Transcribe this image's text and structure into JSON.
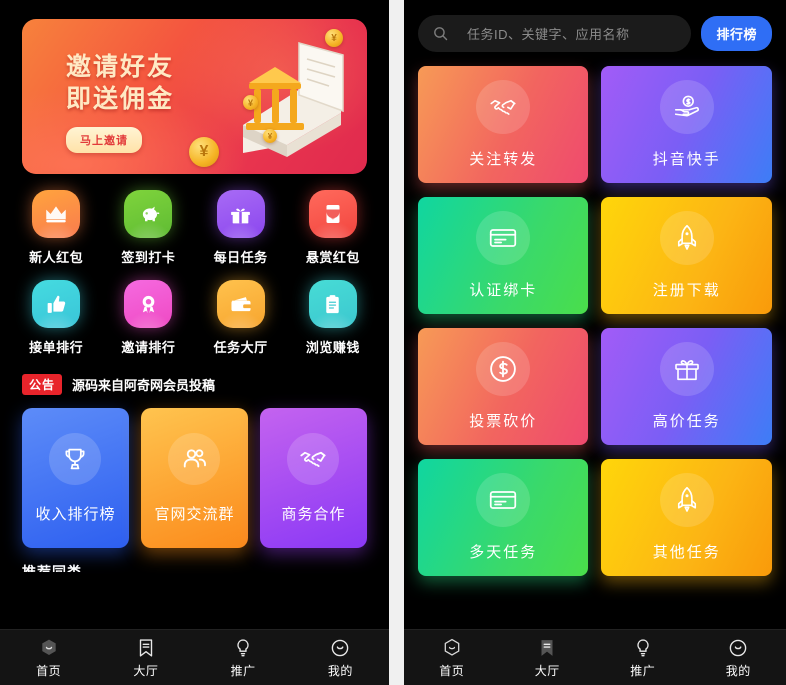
{
  "left_panel": {
    "banner": {
      "line1": "邀请好友",
      "line2": "即送佣金",
      "button": "马上邀请",
      "icon_art": "bank-books-coins-illustration"
    },
    "icon_grid": [
      {
        "label": "新人红包",
        "icon": "crown-icon",
        "color": "#f97b4e"
      },
      {
        "label": "签到打卡",
        "icon": "piggy-bank-icon",
        "color": "#5fbb33"
      },
      {
        "label": "每日任务",
        "icon": "gift-icon",
        "color": "#8b46ee"
      },
      {
        "label": "悬赏红包",
        "icon": "red-packet-icon",
        "color": "#f2453f"
      },
      {
        "label": "接单排行",
        "icon": "thumbs-up-icon",
        "color": "#39c5d8"
      },
      {
        "label": "邀请排行",
        "icon": "medal-icon",
        "color": "#ef49c3"
      },
      {
        "label": "任务大厅",
        "icon": "wallet-icon",
        "color": "#f7a52f"
      },
      {
        "label": "浏览赚钱",
        "icon": "clipboard-icon",
        "color": "#3cc7cf"
      }
    ],
    "notice": {
      "badge": "公告",
      "text": "源码来自阿奇网会员投稿",
      "badge_color": "#e8242b"
    },
    "cards": [
      {
        "label": "收入排行榜",
        "icon": "trophy-icon",
        "color": "#2d5ff0"
      },
      {
        "label": "官网交流群",
        "icon": "people-group-icon",
        "color": "#fb8a1b"
      },
      {
        "label": "商务合作",
        "icon": "handshake-icon",
        "color": "#8a38f5"
      }
    ],
    "section_heading_partial": "推荐同类",
    "tabbar": [
      {
        "label": "首页",
        "icon": "home-hex-smile-icon",
        "active": true
      },
      {
        "label": "大厅",
        "icon": "bookmark-list-icon",
        "active": false
      },
      {
        "label": "推广",
        "icon": "bulb-icon",
        "active": false
      },
      {
        "label": "我的",
        "icon": "user-smile-circle-icon",
        "active": false
      }
    ]
  },
  "right_panel": {
    "search": {
      "placeholder": "任务ID、关键字、应用名称",
      "icon": "search-icon",
      "value": ""
    },
    "rank_button": {
      "label": "排行榜",
      "color": "#2f6ef5"
    },
    "tiles": [
      {
        "label": "关注转发",
        "icon": "handshake-icon",
        "color": "#f2655f"
      },
      {
        "label": "抖音快手",
        "icon": "hand-coin-icon",
        "color": "#7b5ef5"
      },
      {
        "label": "认证绑卡",
        "icon": "credit-card-icon",
        "color": "#3ad96a"
      },
      {
        "label": "注册下载",
        "icon": "rocket-icon",
        "color": "#fcb514"
      },
      {
        "label": "投票砍价",
        "icon": "dollar-circle-icon",
        "color": "#f2655f"
      },
      {
        "label": "高价任务",
        "icon": "gift-icon",
        "color": "#7b5ef5"
      },
      {
        "label": "多天任务",
        "icon": "credit-card-icon",
        "color": "#3ad96a"
      },
      {
        "label": "其他任务",
        "icon": "rocket-icon",
        "color": "#fcb514"
      }
    ],
    "tabbar": [
      {
        "label": "首页",
        "icon": "home-hex-smile-icon",
        "active": false
      },
      {
        "label": "大厅",
        "icon": "bookmark-list-icon",
        "active": true
      },
      {
        "label": "推广",
        "icon": "bulb-icon",
        "active": false
      },
      {
        "label": "我的",
        "icon": "user-smile-circle-icon",
        "active": false
      }
    ]
  }
}
